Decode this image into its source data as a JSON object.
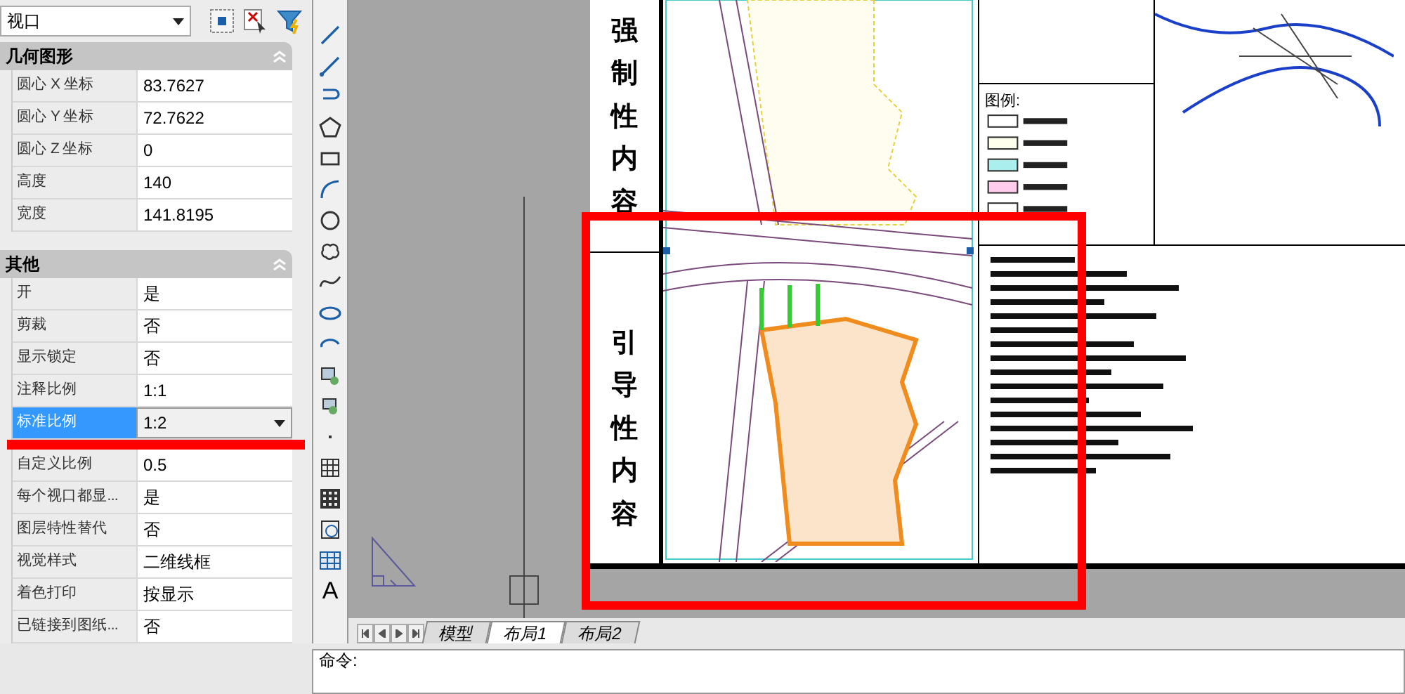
{
  "selector": {
    "value": "视口"
  },
  "sections": [
    {
      "title": "几何图形",
      "expanded": true,
      "rows": [
        {
          "label": "圆心 X 坐标",
          "value": "83.7627",
          "selected": false,
          "kind": "text"
        },
        {
          "label": "圆心 Y 坐标",
          "value": "72.7622",
          "selected": false,
          "kind": "text"
        },
        {
          "label": "圆心 Z 坐标",
          "value": "0",
          "selected": false,
          "kind": "text"
        },
        {
          "label": "高度",
          "value": "140",
          "selected": false,
          "kind": "text"
        },
        {
          "label": "宽度",
          "value": "141.8195",
          "selected": false,
          "kind": "text"
        }
      ]
    },
    {
      "title": "其他",
      "expanded": true,
      "rows": [
        {
          "label": "开",
          "value": "是",
          "selected": false,
          "kind": "text"
        },
        {
          "label": "剪裁",
          "value": "否",
          "selected": false,
          "kind": "text"
        },
        {
          "label": "显示锁定",
          "value": "否",
          "selected": false,
          "kind": "text"
        },
        {
          "label": "注释比例",
          "value": "1:1",
          "selected": false,
          "kind": "text"
        },
        {
          "label": "标准比例",
          "value": "1:2",
          "selected": true,
          "kind": "dropdown"
        },
        {
          "label": "自定义比例",
          "value": "0.5",
          "selected": false,
          "kind": "text"
        },
        {
          "label": "每个视口都显...",
          "value": "是",
          "selected": false,
          "kind": "text"
        },
        {
          "label": "图层特性替代",
          "value": "否",
          "selected": false,
          "kind": "text"
        },
        {
          "label": "视觉样式",
          "value": "二维线框",
          "selected": false,
          "kind": "text"
        },
        {
          "label": "着色打印",
          "value": "按显示",
          "selected": false,
          "kind": "text"
        },
        {
          "label": "已链接到图纸...",
          "value": "否",
          "selected": false,
          "kind": "text"
        }
      ]
    }
  ],
  "sheet": {
    "upper_label": "强制性内容",
    "lower_label": "引导性内容",
    "legend_title": "图例:"
  },
  "layout_tabs": [
    {
      "label": "模型",
      "selected": false
    },
    {
      "label": "布局1",
      "selected": true
    },
    {
      "label": "布局2",
      "selected": false
    }
  ],
  "command_lines": [
    "命令:"
  ],
  "text_tool_glyph": "A"
}
